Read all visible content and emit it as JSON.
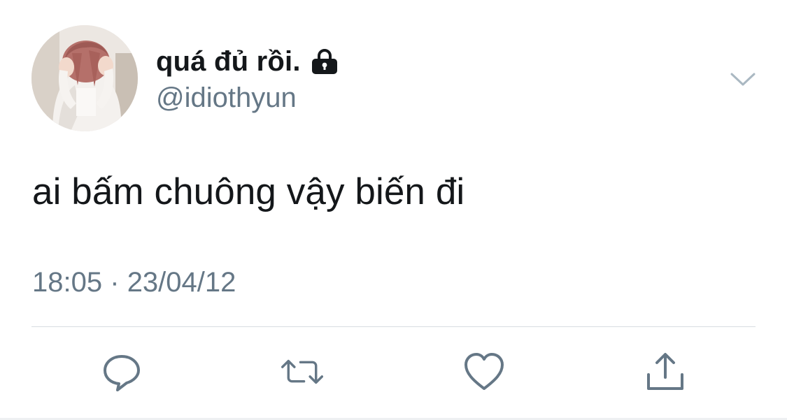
{
  "user": {
    "display_name": "quá đủ rồi.",
    "handle": "@idiothyun",
    "avatar_icon": "avatar-photo",
    "protected_icon": "lock-icon"
  },
  "tweet": {
    "text": "ai bấm chuông vậy biến đi",
    "time": "18:05",
    "separator": "·",
    "date": "23/04/12"
  },
  "actions": {
    "reply_icon": "reply-icon",
    "retweet_icon": "retweet-icon",
    "like_icon": "heart-icon",
    "share_icon": "share-icon",
    "more_icon": "chevron-down-icon"
  },
  "colors": {
    "text_primary": "#14171a",
    "text_secondary": "#657786",
    "icon": "#657786",
    "divider": "#d8dde1"
  }
}
